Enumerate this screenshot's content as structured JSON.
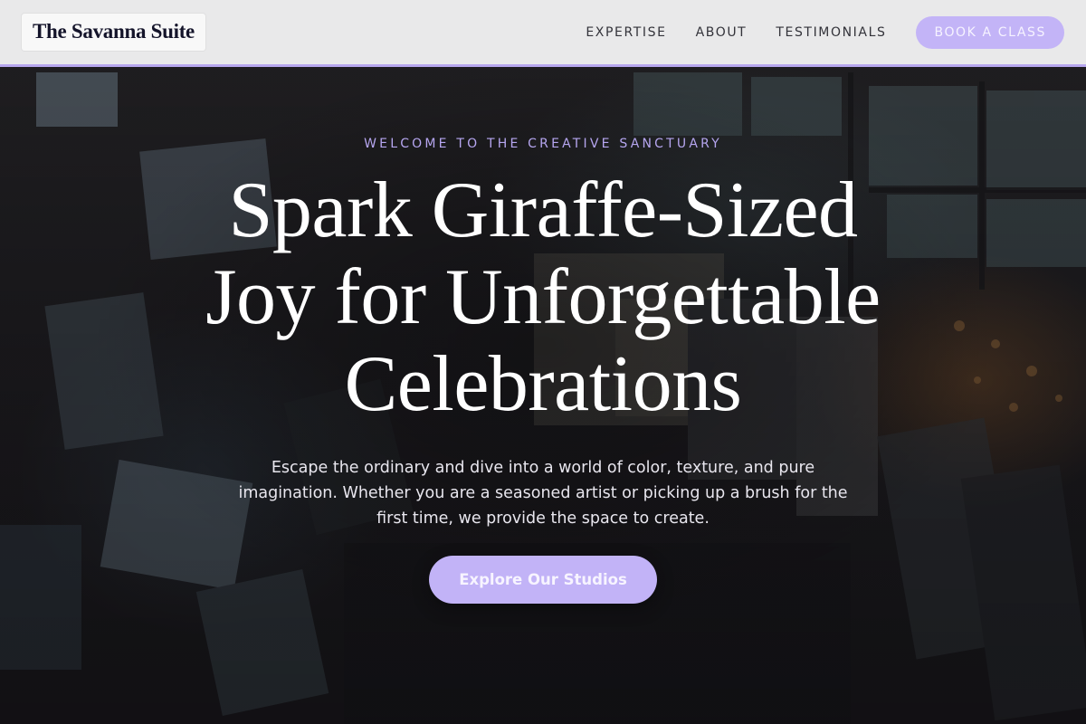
{
  "brand": {
    "name": "The Savanna Suite"
  },
  "nav": {
    "links": [
      "EXPERTISE",
      "ABOUT",
      "TESTIMONIALS"
    ],
    "cta_label": "BOOK A CLASS"
  },
  "hero": {
    "eyebrow": "WELCOME TO THE CREATIVE SANCTUARY",
    "headline_lines": [
      "Spark Giraffe-Sized",
      "Joy for Unforgettable",
      "Celebrations"
    ],
    "subtext": "Escape the ordinary and dive into a world of color, texture, and pure imagination. Whether you are a seasoned artist or picking up a brush for the first time, we provide the space to create.",
    "cta_label": "Explore Our Studios"
  },
  "colors": {
    "accent": "#c3b4f7",
    "accent_border": "#b7a7ee",
    "eyebrow": "#b6a6f0",
    "nav_bg": "#e9e9ea",
    "headline": "#ffffff"
  }
}
